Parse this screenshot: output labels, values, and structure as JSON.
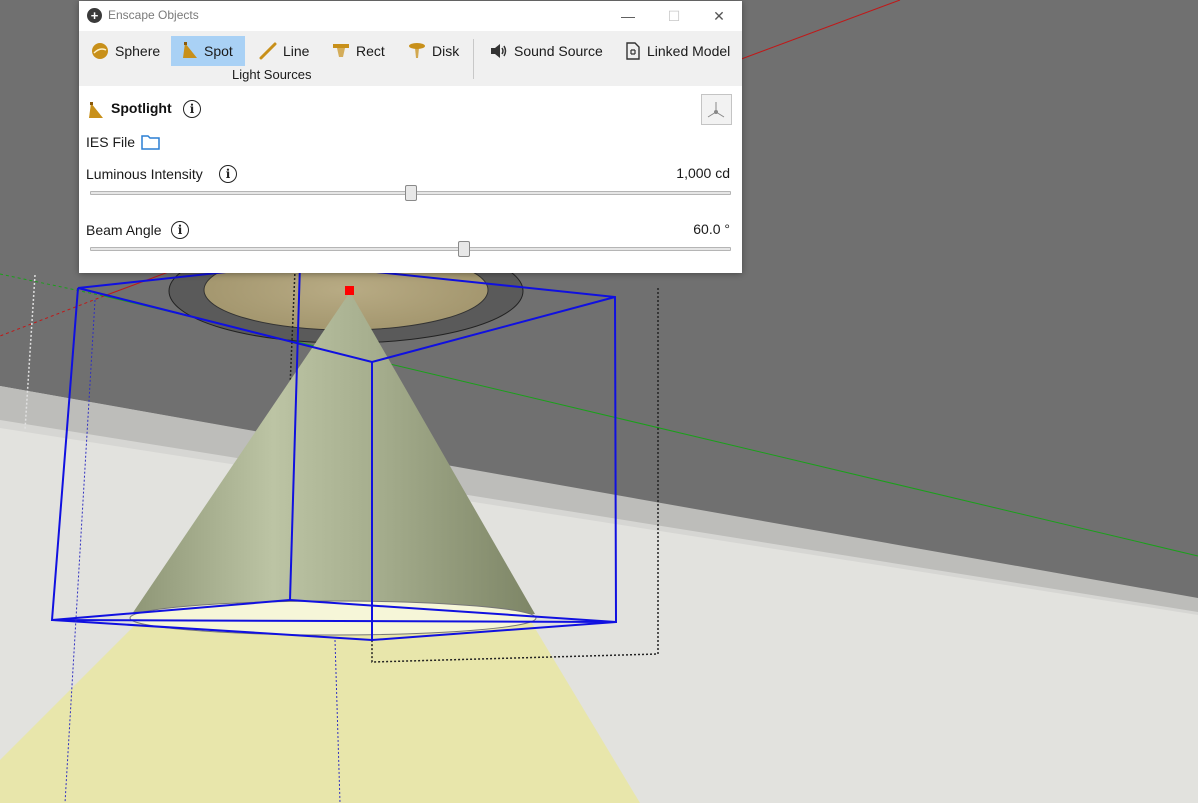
{
  "window": {
    "title": "Enscape Objects",
    "minimize": "—",
    "maximize": "☐",
    "close": "✕"
  },
  "toolbar": {
    "light_items": [
      {
        "label": "Sphere",
        "icon": "sphere-icon"
      },
      {
        "label": "Spot",
        "icon": "spot-icon",
        "selected": true
      },
      {
        "label": "Line",
        "icon": "line-icon"
      },
      {
        "label": "Rect",
        "icon": "rect-icon"
      },
      {
        "label": "Disk",
        "icon": "disk-icon"
      }
    ],
    "group_label": "Light Sources",
    "other_items": [
      {
        "label": "Sound Source",
        "icon": "speaker-icon"
      },
      {
        "label": "Linked Model",
        "icon": "linked-model-icon"
      }
    ]
  },
  "properties": {
    "title": "Spotlight",
    "ies_label": "IES File",
    "luminous": {
      "label": "Luminous Intensity",
      "value": "1,000 cd",
      "slider_fraction": 0.5
    },
    "beam": {
      "label": "Beam Angle",
      "value": "60.0 °",
      "slider_fraction": 0.584
    }
  },
  "colors": {
    "accent_selected": "#a9d1f5",
    "icon_gold": "#c8901a",
    "folder_blue": "#2a7fd4",
    "selection_blue": "#1010e0",
    "cone_green": "#a6ae8e",
    "light_yellow": "#e8e6a0"
  }
}
